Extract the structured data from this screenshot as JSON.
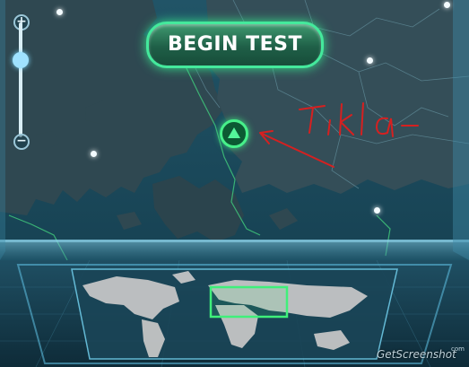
{
  "header": {
    "begin_test_label": "BEGIN TEST"
  },
  "zoom": {
    "in_label": "+",
    "out_label": "−"
  },
  "annotation": {
    "handwritten_text": "Tıkla"
  },
  "watermark": {
    "text": "GetScreenshot",
    "suffix": "com"
  },
  "colors": {
    "accent_green": "#44e99c",
    "map_sea": "#1c4a5c",
    "map_land": "#2d4a55",
    "panel_glass": "#6fb4cf",
    "annotation_red": "#d62020"
  },
  "icons": [
    "zoom-in-icon",
    "zoom-out-icon",
    "server-marker-icon",
    "arrow-annotation-icon"
  ]
}
